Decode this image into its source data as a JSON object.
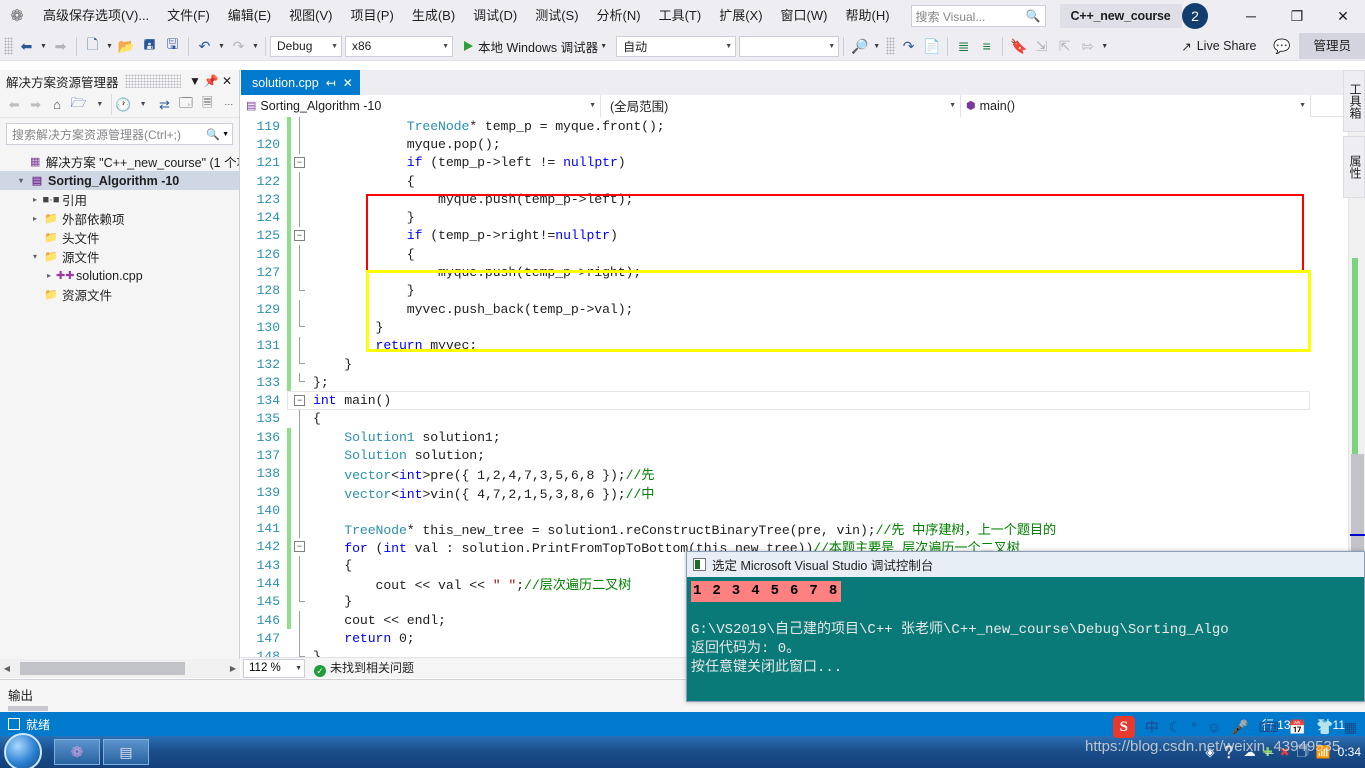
{
  "menubar": {
    "logo_icon": "visual-studio-logo",
    "items": [
      "高级保存选项(V)...",
      "文件(F)",
      "编辑(E)",
      "视图(V)",
      "项目(P)",
      "生成(B)",
      "调试(D)",
      "测试(S)",
      "分析(N)",
      "工具(T)",
      "扩展(X)",
      "窗口(W)",
      "帮助(H)"
    ],
    "search_placeholder": "搜索 Visual...",
    "search_icon": "magnifier-icon",
    "project_chip": "C++_new_course",
    "notification_count": "2",
    "minimize_label": "─",
    "maximize_label": "❐",
    "close_label": "✕"
  },
  "toolbar": {
    "nav_back_icon": "arrow-back-icon",
    "nav_forward_icon": "arrow-forward-icon",
    "new_item_icon": "new-item-icon",
    "open_icon": "open-folder-icon",
    "save_icon": "save-icon",
    "save_all_icon": "save-all-icon",
    "undo_icon": "undo-icon",
    "redo_icon": "redo-icon",
    "config_value": "Debug",
    "platform_value": "x86",
    "run_label": "本地 Windows 调试器",
    "run_icon": "play-icon",
    "auto_value": "自动",
    "blank_value": "",
    "find_icon": "find-in-files-icon",
    "indent_icon": "indent-icon",
    "comment_icon": "comment-icon",
    "format_icon": "format-icon",
    "help_list_icon": "help-list-icon",
    "bookmark_icon": "bookmark-icon",
    "step_icon_1": "step-into-icon",
    "step_icon_2": "step-over-icon",
    "step_icon_3": "step-out-icon",
    "live_share_label": "Live Share",
    "live_share_icon": "share-icon",
    "feedback_icon": "feedback-icon",
    "admin_label": "管理员"
  },
  "solution_explorer": {
    "title": "解决方案资源管理器",
    "dropdown_icon": "chevron-down-icon",
    "pin_icon": "pin-icon",
    "close_icon": "close-icon",
    "toolbar_icons": [
      "back-icon",
      "forward-icon",
      "home-icon",
      "show-all-files-icon",
      "dropdown-icon",
      "refresh-history-icon",
      "sync-icon",
      "collapse-all-icon",
      "properties-icon",
      "overflow-icon"
    ],
    "search_placeholder": "搜索解决方案资源管理器(Ctrl+;)",
    "search_icon": "magnifier-icon",
    "search_dropdown_icon": "chevron-down-icon",
    "tree": [
      {
        "label": "解决方案 \"C++_new_course\" (1 个项",
        "icon": "solution-icon",
        "indent": 1,
        "expander": "",
        "selected": false,
        "bold": false
      },
      {
        "label": "Sorting_Algorithm -10",
        "icon": "cpp-project-icon",
        "indent": 1,
        "expander": "▾",
        "selected": true,
        "bold": true
      },
      {
        "label": "引用",
        "icon": "references-icon",
        "indent": 2,
        "expander": "▸",
        "selected": false,
        "bold": false
      },
      {
        "label": "外部依赖项",
        "icon": "folder-icon",
        "indent": 2,
        "expander": "▸",
        "selected": false,
        "bold": false
      },
      {
        "label": "头文件",
        "icon": "folder-icon",
        "indent": 2,
        "expander": "",
        "selected": false,
        "bold": false
      },
      {
        "label": "源文件",
        "icon": "folder-icon",
        "indent": 2,
        "expander": "▾",
        "selected": false,
        "bold": false
      },
      {
        "label": "solution.cpp",
        "icon": "cpp-file-icon",
        "indent": 3,
        "expander": "▸",
        "selected": false,
        "bold": false
      },
      {
        "label": "资源文件",
        "icon": "folder-icon",
        "indent": 2,
        "expander": "",
        "selected": false,
        "bold": false
      }
    ]
  },
  "editor": {
    "tab_label": "solution.cpp",
    "tab_pin_icon": "pin-icon",
    "tab_close_icon": "close-icon",
    "tabstrip_overflow_icon": "chevron-down-icon",
    "nav_project": "Sorting_Algorithm -10",
    "nav_project_icon": "cpp-project-icon",
    "nav_scope": "(全局范围)",
    "nav_member": "main()",
    "nav_member_icon": "method-icon",
    "zoom_level": "112 %",
    "issue_status": "未找到相关问题",
    "issue_icon": "check-circle-icon",
    "lines": [
      {
        "n": "119",
        "chg": true,
        "fold": "line",
        "text": "            TreeNode* temp_p = myque.front();",
        "tokens": [
          {
            "t": "            ",
            "c": "pl"
          },
          {
            "t": "TreeNode",
            "c": "ty"
          },
          {
            "t": "* temp_p = myque.front();",
            "c": "pl"
          }
        ]
      },
      {
        "n": "120",
        "chg": true,
        "fold": "line",
        "text": "            myque.pop();",
        "tokens": [
          {
            "t": "            myque.pop();",
            "c": "pl"
          }
        ]
      },
      {
        "n": "121",
        "chg": true,
        "fold": "box",
        "text": "            if (temp_p->left != nullptr)",
        "tokens": [
          {
            "t": "            ",
            "c": "pl"
          },
          {
            "t": "if",
            "c": "kw"
          },
          {
            "t": " (temp_p->left != ",
            "c": "pl"
          },
          {
            "t": "nullptr",
            "c": "kw"
          },
          {
            "t": ")",
            "c": "pl"
          }
        ]
      },
      {
        "n": "122",
        "chg": true,
        "fold": "line",
        "text": "            {",
        "tokens": [
          {
            "t": "            {",
            "c": "pl"
          }
        ]
      },
      {
        "n": "123",
        "chg": true,
        "fold": "line",
        "text": "                myque.push(temp_p->left);",
        "tokens": [
          {
            "t": "                myque.push(temp_p->left);",
            "c": "pl"
          }
        ]
      },
      {
        "n": "124",
        "chg": true,
        "fold": "line",
        "text": "            }",
        "tokens": [
          {
            "t": "            }",
            "c": "pl"
          }
        ]
      },
      {
        "n": "125",
        "chg": true,
        "fold": "box",
        "text": "            if (temp_p->right!=nullptr)",
        "tokens": [
          {
            "t": "            ",
            "c": "pl"
          },
          {
            "t": "if",
            "c": "kw"
          },
          {
            "t": " (temp_p->right!=",
            "c": "pl"
          },
          {
            "t": "nullptr",
            "c": "kw"
          },
          {
            "t": ")",
            "c": "pl"
          }
        ]
      },
      {
        "n": "126",
        "chg": true,
        "fold": "line",
        "text": "            {",
        "tokens": [
          {
            "t": "            {",
            "c": "pl"
          }
        ]
      },
      {
        "n": "127",
        "chg": true,
        "fold": "line",
        "text": "                myque.push(temp_p->right);",
        "tokens": [
          {
            "t": "                myque.push(temp_p->right);",
            "c": "pl"
          }
        ]
      },
      {
        "n": "128",
        "chg": true,
        "fold": "endl",
        "text": "            }",
        "tokens": [
          {
            "t": "            }",
            "c": "pl"
          }
        ]
      },
      {
        "n": "129",
        "chg": true,
        "fold": "line",
        "text": "            myvec.push_back(temp_p->val);",
        "tokens": [
          {
            "t": "            myvec.push_back(temp_p->val);",
            "c": "pl"
          }
        ]
      },
      {
        "n": "130",
        "chg": true,
        "fold": "endl",
        "text": "        }",
        "tokens": [
          {
            "t": "        }",
            "c": "pl"
          }
        ]
      },
      {
        "n": "131",
        "chg": true,
        "fold": "line",
        "text": "        return myvec;",
        "tokens": [
          {
            "t": "        ",
            "c": "pl"
          },
          {
            "t": "return",
            "c": "kw"
          },
          {
            "t": " myvec;",
            "c": "pl"
          }
        ]
      },
      {
        "n": "132",
        "chg": true,
        "fold": "endl",
        "text": "    }",
        "tokens": [
          {
            "t": "    }",
            "c": "pl"
          }
        ]
      },
      {
        "n": "133",
        "chg": true,
        "fold": "endl",
        "text": "};",
        "tokens": [
          {
            "t": "};",
            "c": "pl"
          }
        ]
      },
      {
        "n": "134",
        "chg": false,
        "fold": "box",
        "text": "int main()",
        "current": true,
        "tokens": [
          {
            "t": "int",
            "c": "kw"
          },
          {
            "t": " main()",
            "c": "pl"
          }
        ]
      },
      {
        "n": "135",
        "chg": false,
        "fold": "line",
        "text": "{",
        "tokens": [
          {
            "t": "{",
            "c": "pl"
          }
        ]
      },
      {
        "n": "136",
        "chg": true,
        "fold": "line",
        "text": "    Solution1 solution1;",
        "tokens": [
          {
            "t": "    ",
            "c": "pl"
          },
          {
            "t": "Solution1",
            "c": "ty"
          },
          {
            "t": " solution1;",
            "c": "pl"
          }
        ]
      },
      {
        "n": "137",
        "chg": true,
        "fold": "line",
        "text": "    Solution solution;",
        "tokens": [
          {
            "t": "    ",
            "c": "pl"
          },
          {
            "t": "Solution",
            "c": "ty"
          },
          {
            "t": " solution;",
            "c": "pl"
          }
        ]
      },
      {
        "n": "138",
        "chg": true,
        "fold": "line",
        "text": "    vector<int>pre({ 1,2,4,7,3,5,6,8 });//先",
        "tokens": [
          {
            "t": "    ",
            "c": "pl"
          },
          {
            "t": "vector",
            "c": "ty"
          },
          {
            "t": "<",
            "c": "pl"
          },
          {
            "t": "int",
            "c": "kw"
          },
          {
            "t": ">pre({ 1,2,4,7,3,5,6,8 });",
            "c": "pl"
          },
          {
            "t": "//先",
            "c": "cm"
          }
        ]
      },
      {
        "n": "139",
        "chg": true,
        "fold": "line",
        "text": "    vector<int>vin({ 4,7,2,1,5,3,8,6 });//中",
        "tokens": [
          {
            "t": "    ",
            "c": "pl"
          },
          {
            "t": "vector",
            "c": "ty"
          },
          {
            "t": "<",
            "c": "pl"
          },
          {
            "t": "int",
            "c": "kw"
          },
          {
            "t": ">vin({ 4,7,2,1,5,3,8,6 });",
            "c": "pl"
          },
          {
            "t": "//中",
            "c": "cm"
          }
        ]
      },
      {
        "n": "140",
        "chg": true,
        "fold": "line",
        "text": "",
        "tokens": [
          {
            "t": "",
            "c": "pl"
          }
        ]
      },
      {
        "n": "141",
        "chg": true,
        "fold": "line",
        "text": "    TreeNode* this_new_tree = solution1.reConstructBinaryTree(pre, vin);//先 中序建树，上一个题目的",
        "tokens": [
          {
            "t": "    ",
            "c": "pl"
          },
          {
            "t": "TreeNode",
            "c": "ty"
          },
          {
            "t": "* this_new_tree = solution1.reConstructBinaryTree(pre, vin);",
            "c": "pl"
          },
          {
            "t": "//先 中序建树，上一个题目的",
            "c": "cm"
          }
        ]
      },
      {
        "n": "142",
        "chg": true,
        "fold": "box",
        "text": "    for (int val : solution.PrintFromTopToBottom(this_new_tree))//本题主要是 层次遍历一个二叉树",
        "tokens": [
          {
            "t": "    ",
            "c": "pl"
          },
          {
            "t": "for",
            "c": "kw"
          },
          {
            "t": " (",
            "c": "pl"
          },
          {
            "t": "int",
            "c": "kw"
          },
          {
            "t": " val : solution.PrintFromTopToBottom(this_new_tree))",
            "c": "pl"
          },
          {
            "t": "//本题主要是 层次遍历一个二叉树",
            "c": "cm"
          }
        ]
      },
      {
        "n": "143",
        "chg": true,
        "fold": "line",
        "text": "    {",
        "tokens": [
          {
            "t": "    {",
            "c": "pl"
          }
        ]
      },
      {
        "n": "144",
        "chg": true,
        "fold": "line",
        "text": "        cout << val << \" \";//层次遍历二叉树",
        "tokens": [
          {
            "t": "        cout << val << ",
            "c": "pl"
          },
          {
            "t": "\" \"",
            "c": "st"
          },
          {
            "t": ";",
            "c": "pl"
          },
          {
            "t": "//层次遍历二叉树",
            "c": "cm"
          }
        ]
      },
      {
        "n": "145",
        "chg": true,
        "fold": "endl",
        "text": "    }",
        "tokens": [
          {
            "t": "    }",
            "c": "pl"
          }
        ]
      },
      {
        "n": "146",
        "chg": true,
        "fold": "line",
        "text": "    cout << endl;",
        "tokens": [
          {
            "t": "    cout << endl;",
            "c": "pl"
          }
        ]
      },
      {
        "n": "147",
        "chg": false,
        "fold": "line",
        "text": "    return 0;",
        "tokens": [
          {
            "t": "    ",
            "c": "pl"
          },
          {
            "t": "return",
            "c": "kw"
          },
          {
            "t": " 0;",
            "c": "pl"
          }
        ]
      },
      {
        "n": "148",
        "chg": false,
        "fold": "endl",
        "text": "}",
        "tokens": [
          {
            "t": "}",
            "c": "pl"
          }
        ]
      }
    ],
    "annotations": [
      {
        "kind": "red-rect",
        "note": "highlight around lines 138-141"
      },
      {
        "kind": "yellow-rect",
        "note": "highlight around lines 142-146"
      }
    ]
  },
  "output_pane": {
    "label": "输出"
  },
  "statusbar": {
    "ready": "就绪",
    "ready_icon": "flag-icon",
    "line_label": "行 134",
    "col_label": "列 11"
  },
  "right_tabs": {
    "toolbox": "工具箱",
    "properties": "属性"
  },
  "console_window": {
    "title": "选定 Microsoft Visual Studio 调试控制台",
    "title_icon": "console-icon",
    "program_output": "1 2 3 4 5 6 7 8",
    "path_line": "G:\\VS2019\\自己建的项目\\C++ 张老师\\C++_new_course\\Debug\\Sorting_Algo",
    "return_line": "返回代码为: 0。",
    "prompt_line": "按任意键关闭此窗口..."
  },
  "taskbar": {
    "start_icon": "windows-start-icon",
    "tasks": [
      "visual-studio-icon",
      "console-window-icon"
    ],
    "tray_icons": [
      "sogou-icon",
      "ime-chinese-icon",
      "moon-icon",
      "degree-icon",
      "smiley-icon",
      "mic-icon",
      "keyboard-icon",
      "calendar-icon",
      "shirt-icon",
      "grid-icon"
    ],
    "tray_bottom_icons": [
      "sogou-icon",
      "help-icon",
      "cloud-icon",
      "plus-icon",
      "error-icon",
      "copy-icon",
      "signal-icon"
    ],
    "clock": "0:34"
  },
  "watermark": {
    "text": "https://blog.csdn.net/weixin_43949535"
  }
}
